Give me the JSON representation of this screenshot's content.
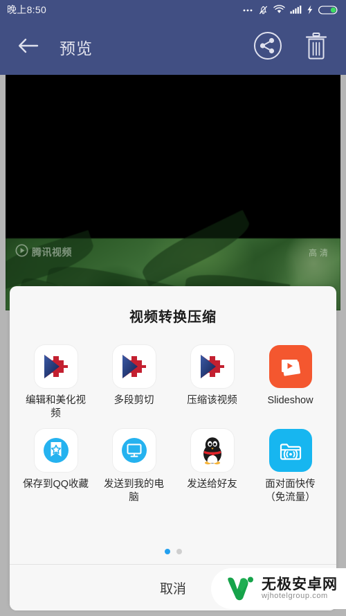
{
  "status_bar": {
    "time": "晚上8:50",
    "icons": [
      "more-dots-icon",
      "notifications-muted-icon",
      "wifi-icon",
      "cellular-signal-icon",
      "charging-bolt-icon",
      "battery-icon"
    ]
  },
  "app_bar": {
    "back_icon": "arrow-left-icon",
    "title": "预览",
    "share_icon": "share-nodes-icon",
    "delete_icon": "trash-icon"
  },
  "video_preview": {
    "tencent_watermark": "腾讯视频",
    "quality_label": "高清",
    "play_icon": "play-circle-icon"
  },
  "share_sheet": {
    "title": "视频转换压缩",
    "items": [
      {
        "label": "编辑和美化视频",
        "icon": "videoshow-app-icon"
      },
      {
        "label": "多段剪切",
        "icon": "videoshow-app-icon"
      },
      {
        "label": "压缩该视频",
        "icon": "videoshow-app-icon"
      },
      {
        "label": "Slideshow",
        "icon": "slideshow-app-icon"
      },
      {
        "label": "保存到QQ收藏",
        "icon": "qq-favorites-icon"
      },
      {
        "label": "发送到我的电脑",
        "icon": "send-to-my-computer-icon"
      },
      {
        "label": "发送给好友",
        "icon": "qq-penguin-icon"
      },
      {
        "label": "面对面快传（免流量）",
        "icon": "face-to-face-transfer-icon"
      }
    ],
    "pagination": {
      "total": 2,
      "active": 1
    },
    "cancel_label": "取消"
  },
  "site_watermark": {
    "name_cn": "无极安卓网",
    "url": "wjhotelgroup.com",
    "logo_icon": "w-logo-icon"
  },
  "colors": {
    "app_bar": "#414f83",
    "sheet_bg": "#f7f7f7",
    "accent_blue": "#23a0ef",
    "slideshow_orange": "#f4572f",
    "dot_active": "#23a0ef"
  }
}
